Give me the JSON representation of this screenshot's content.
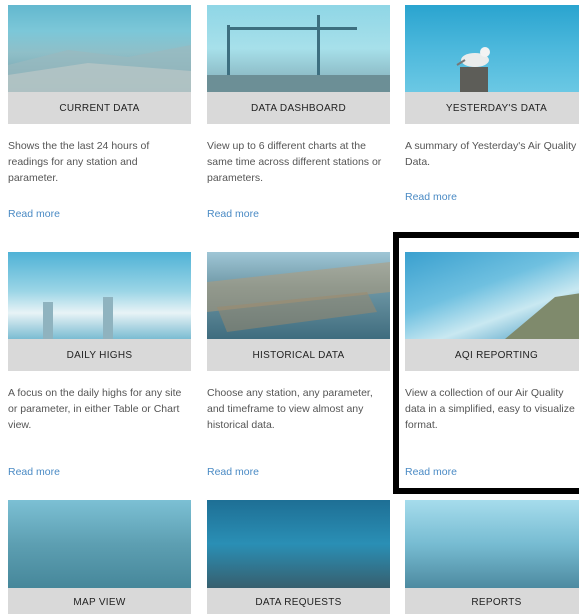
{
  "cards": [
    {
      "title": "CURRENT DATA",
      "desc": "Shows the the last 24 hours of readings for any station and parameter.",
      "link": "Read more"
    },
    {
      "title": "DATA DASHBOARD",
      "desc": "View up to 6 different charts at the same time across different stations or parameters.",
      "link": "Read more"
    },
    {
      "title": "YESTERDAY'S DATA",
      "desc": "A summary of Yesterday's Air Quality Data.",
      "link": "Read more"
    },
    {
      "title": "DAILY HIGHS",
      "desc": "A focus on the daily highs for any site or parameter, in either Table or Chart view.",
      "link": "Read more"
    },
    {
      "title": "HISTORICAL DATA",
      "desc": "Choose any station, any parameter, and timeframe to view almost any historical data.",
      "link": "Read more"
    },
    {
      "title": "AQI REPORTING",
      "desc": "View a collection of our Air Quality data in a simplified, easy to visualize format.",
      "link": "Read more"
    },
    {
      "title": "MAP VIEW"
    },
    {
      "title": "DATA REQUESTS"
    },
    {
      "title": "REPORTS"
    }
  ]
}
